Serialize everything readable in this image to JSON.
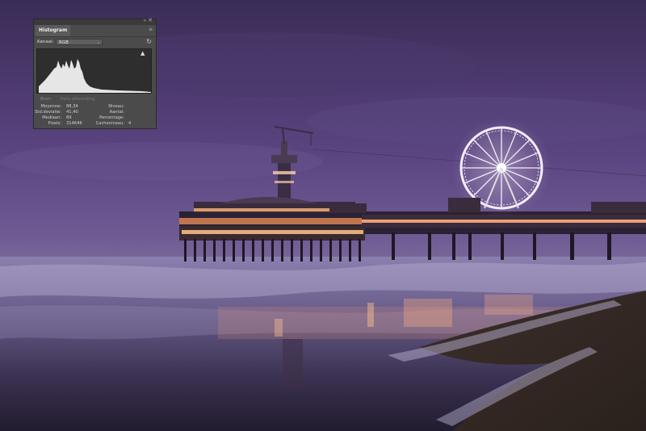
{
  "histogram_panel": {
    "tab_label": "Histogram",
    "kanaal_label": "Kanaal:",
    "kanaal_value": "RGB",
    "bron_label": "Bron:",
    "bron_value": "Hele afbeelding",
    "stats_left": [
      {
        "label": "Moyenne:",
        "value": "88,34"
      },
      {
        "label": "Std.deviatie:",
        "value": "41,40"
      },
      {
        "label": "Mediaan:",
        "value": "89"
      },
      {
        "label": "Pixels:",
        "value": "314646"
      }
    ],
    "stats_right": [
      {
        "label": "Niveau:",
        "value": ""
      },
      {
        "label": "Aantal:",
        "value": ""
      },
      {
        "label": "Percentage:",
        "value": ""
      },
      {
        "label": "Cacheniveau:",
        "value": "4"
      }
    ],
    "icons": [
      "close-icon",
      "collapse-icon",
      "panel-menu-icon",
      "refresh-icon",
      "clipping-warning-icon",
      "chevron-down-icon"
    ]
  },
  "colors": {
    "panel_bg": "#4b4b4b",
    "histogram_fill": "#e6e6e6",
    "sky_top": "#3d2f5c",
    "ferris_wheel": "#f3eefc",
    "pier_lights": "#ffb070"
  }
}
